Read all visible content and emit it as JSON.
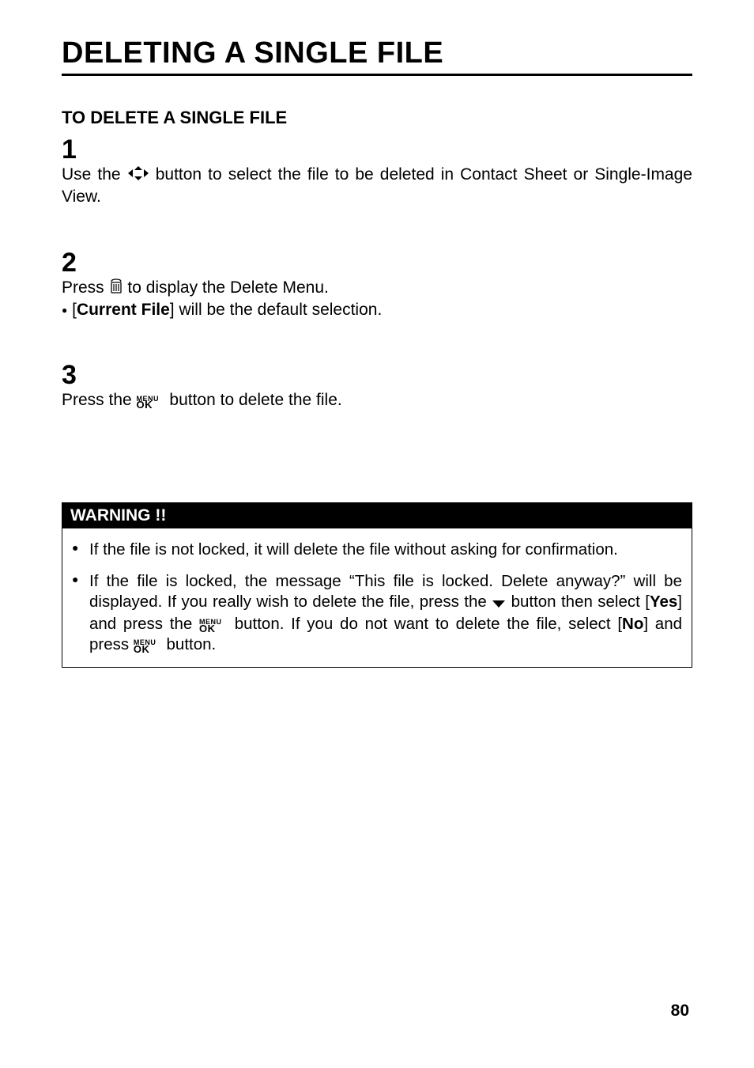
{
  "page": {
    "title": "DELETING A SINGLE FILE",
    "subhead": "TO DELETE A SINGLE FILE",
    "steps": {
      "s1": {
        "num": "1",
        "pre": "Use the ",
        "post": " button to select the file to be deleted in Contact Sheet or Single-Image View."
      },
      "s2": {
        "num": "2",
        "line1a": "Press ",
        "line1b": " to display the Delete Menu.",
        "line2a": "[",
        "line2bold": "Current File",
        "line2b": "] will be the default selection."
      },
      "s3": {
        "num": "3",
        "pre": "Press the  ",
        "post": " button to delete the file."
      }
    },
    "warning": {
      "title": "WARNING !!",
      "item1": "If the file is not locked, it will delete the file without asking for confirmation.",
      "item2": {
        "t1": "If the file is locked, the message “This file is locked. Delete anyway?” will be displayed. If you really wish to delete the file, press the ",
        "t2": " button then select  [",
        "yes": "Yes",
        "t3": "] and press the ",
        "t4": " button. If you do not want to delete the file, select [",
        "no": "No",
        "t5": "] and press ",
        "t6": " button."
      }
    },
    "pagenum": "80"
  }
}
